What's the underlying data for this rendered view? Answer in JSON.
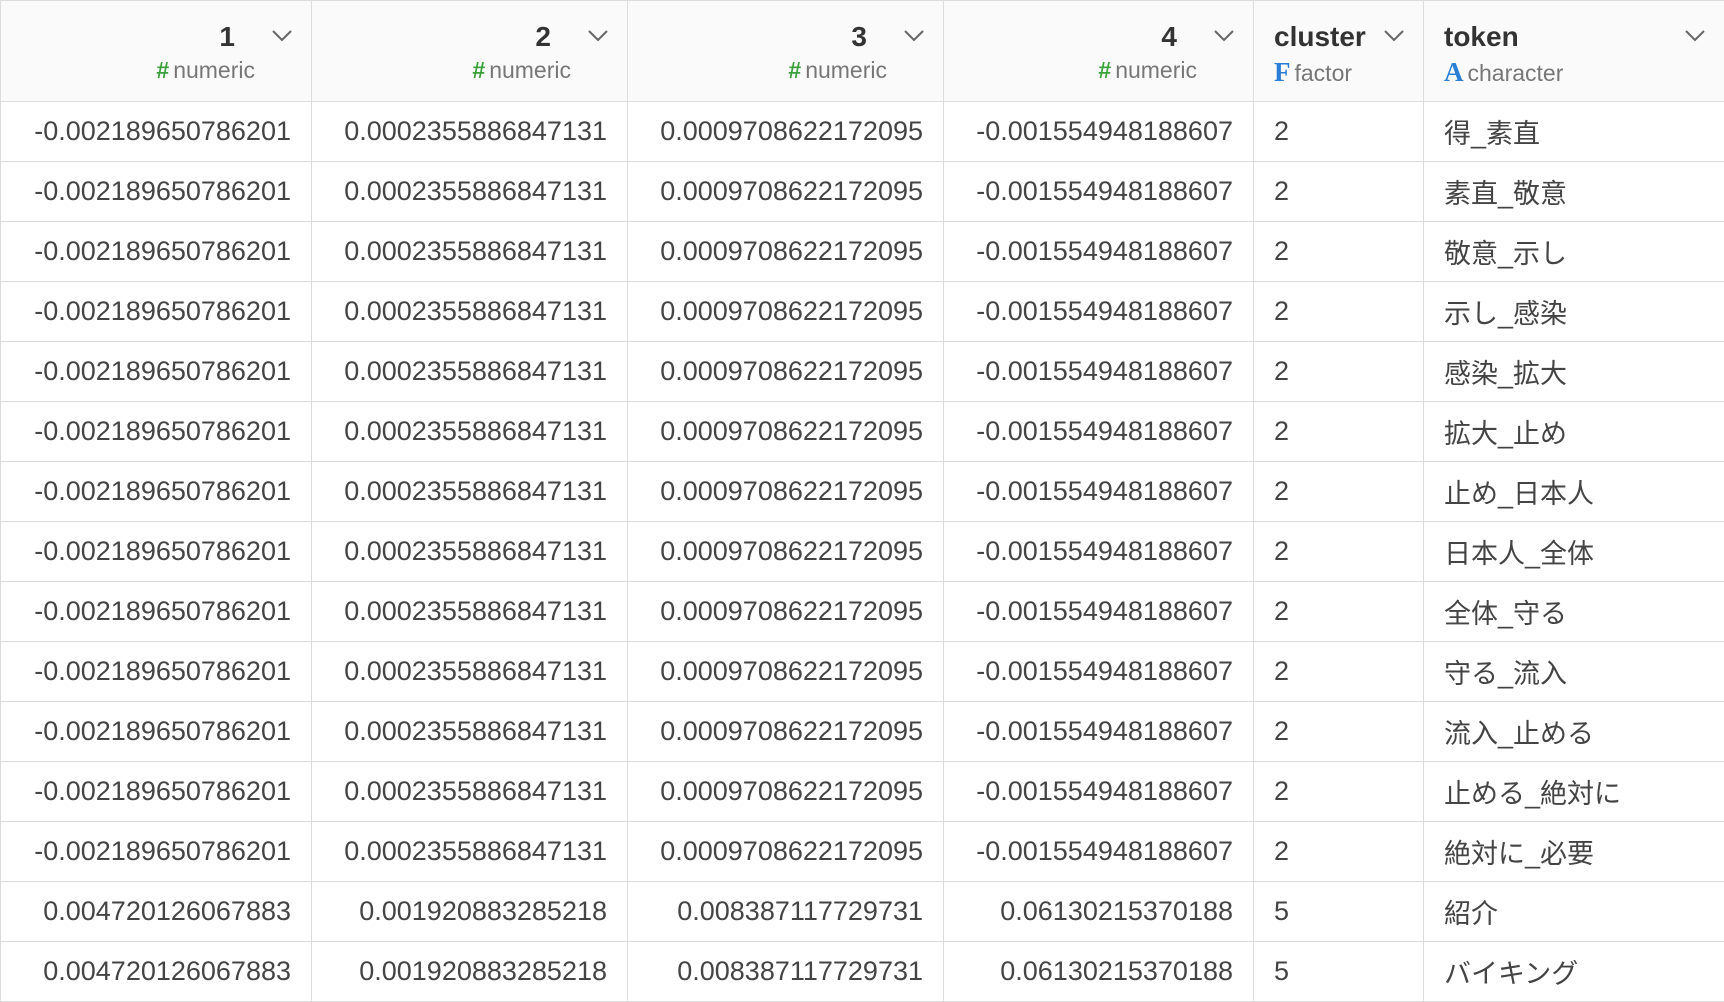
{
  "columns": [
    {
      "name": "1",
      "type_icon": "#",
      "type_label": "numeric"
    },
    {
      "name": "2",
      "type_icon": "#",
      "type_label": "numeric"
    },
    {
      "name": "3",
      "type_icon": "#",
      "type_label": "numeric"
    },
    {
      "name": "4",
      "type_icon": "#",
      "type_label": "numeric"
    },
    {
      "name": "cluster",
      "type_icon": "F",
      "type_label": "factor"
    },
    {
      "name": "token",
      "type_icon": "A",
      "type_label": "character"
    }
  ],
  "icons": {
    "numeric": "hash-icon",
    "factor": "factor-f-icon",
    "character": "character-a-icon",
    "menu": "chevron-down-icon"
  },
  "colors": {
    "numeric_icon": "#3aa13a",
    "factor_icon": "#2a7fd4",
    "character_icon": "#2a7fd4"
  },
  "rows": [
    [
      "-0.002189650786201",
      "0.0002355886847131",
      "0.0009708622172095",
      "-0.001554948188607",
      "2",
      "得_素直"
    ],
    [
      "-0.002189650786201",
      "0.0002355886847131",
      "0.0009708622172095",
      "-0.001554948188607",
      "2",
      "素直_敬意"
    ],
    [
      "-0.002189650786201",
      "0.0002355886847131",
      "0.0009708622172095",
      "-0.001554948188607",
      "2",
      "敬意_示し"
    ],
    [
      "-0.002189650786201",
      "0.0002355886847131",
      "0.0009708622172095",
      "-0.001554948188607",
      "2",
      "示し_感染"
    ],
    [
      "-0.002189650786201",
      "0.0002355886847131",
      "0.0009708622172095",
      "-0.001554948188607",
      "2",
      "感染_拡大"
    ],
    [
      "-0.002189650786201",
      "0.0002355886847131",
      "0.0009708622172095",
      "-0.001554948188607",
      "2",
      "拡大_止め"
    ],
    [
      "-0.002189650786201",
      "0.0002355886847131",
      "0.0009708622172095",
      "-0.001554948188607",
      "2",
      "止め_日本人"
    ],
    [
      "-0.002189650786201",
      "0.0002355886847131",
      "0.0009708622172095",
      "-0.001554948188607",
      "2",
      "日本人_全体"
    ],
    [
      "-0.002189650786201",
      "0.0002355886847131",
      "0.0009708622172095",
      "-0.001554948188607",
      "2",
      "全体_守る"
    ],
    [
      "-0.002189650786201",
      "0.0002355886847131",
      "0.0009708622172095",
      "-0.001554948188607",
      "2",
      "守る_流入"
    ],
    [
      "-0.002189650786201",
      "0.0002355886847131",
      "0.0009708622172095",
      "-0.001554948188607",
      "2",
      "流入_止める"
    ],
    [
      "-0.002189650786201",
      "0.0002355886847131",
      "0.0009708622172095",
      "-0.001554948188607",
      "2",
      "止める_絶対に"
    ],
    [
      "-0.002189650786201",
      "0.0002355886847131",
      "0.0009708622172095",
      "-0.001554948188607",
      "2",
      "絶対に_必要"
    ],
    [
      "0.004720126067883",
      "0.001920883285218",
      "0.008387117729731",
      "0.06130215370188",
      "5",
      "紹介"
    ],
    [
      "0.004720126067883",
      "0.001920883285218",
      "0.008387117729731",
      "0.06130215370188",
      "5",
      "バイキング"
    ]
  ]
}
